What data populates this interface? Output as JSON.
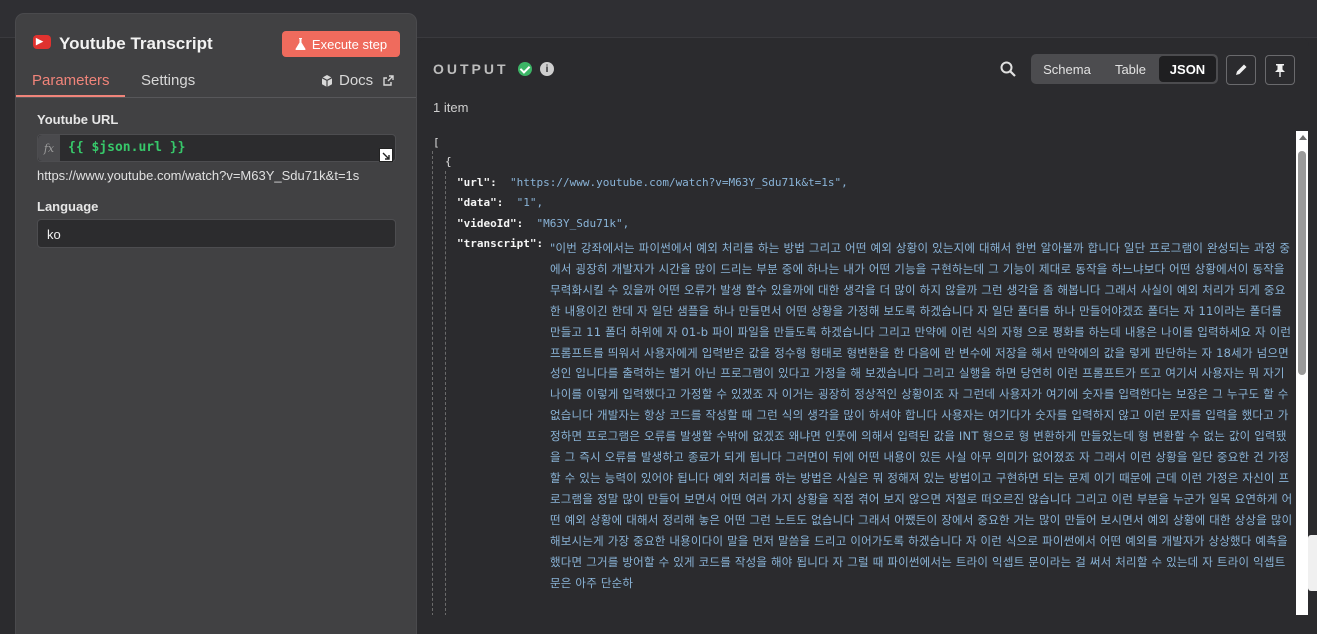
{
  "node": {
    "title": "Youtube Transcript",
    "icon": "youtube-icon",
    "icon_color": "#e0322f",
    "execute_label": "Execute step",
    "accent": "#ef6b5d"
  },
  "tabs": {
    "parameters": "Parameters",
    "settings": "Settings",
    "docs": "Docs"
  },
  "params": {
    "url_label": "Youtube URL",
    "fx": "fx",
    "url_expression": "{{ $json.url }}",
    "url_preview": "https://www.youtube.com/watch?v=M63Y_Sdu71k&t=1s",
    "language_label": "Language",
    "language_value": "ko"
  },
  "output": {
    "title": "OUTPUT",
    "items_count": "1 item",
    "views": [
      "Schema",
      "Table",
      "JSON"
    ],
    "active_view": "JSON",
    "json": {
      "open_bracket": "[",
      "open_brace": "{",
      "url_key": "\"url\":",
      "url_val": "\"https://www.youtube.com/watch?v=M63Y_Sdu71k&t=1s\",",
      "data_key": "\"data\":",
      "data_val": "\"1\",",
      "videoId_key": "\"videoId\":",
      "videoId_val": "\"M63Y_Sdu71k\",",
      "transcript_key": "\"transcript\":",
      "transcript_val": "\"이번 강좌에서는 파이썬에서 예외 처리를 하는 방법 그리고 어떤 예외 상황이 있는지에 대해서 한번 알아볼까 합니다 일단 프로그램이 완성되는 과정 중에서 굉장히 개발자가 시간을 많이 드리는 부분 중에 하나는 내가 어떤 기능을 구현하는데 그 기능이 제대로 동작을 하느냐보다 어떤 상황에서이 동작을 무력화시킬 수 있을까 어떤 오류가 발생 할수 있을까에 대한 생각을 더 많이 하지 않을까 그런 생각을 좀 해봅니다 그래서 사실이 예외 처리가 되게 중요한 내용이긴 한데 자 일단 샘플을 하나 만들면서 어떤 상황을 가정해 보도록 하겠습니다 자 일단 폴더를 하나 만들어야겠죠 폴더는 자 11이라는 폴더를 만들고 11 폴더 하위에 자 01-b 파이 파일을 만들도록 하겠습니다 그리고 만약에 이런 식의 자형 으로 평화를 하는데 내용은 나이를 입력하세요 자 이런 프롬프트를 띄워서 사용자에게 입력받은 값을 정수형 형태로 형변환을 한 다음에 란 변수에 저장을 해서 만약에의 값을 렇게 판단하는 자 18세가 넘으면 성인 입니다를 출력하는 별거 아닌 프로그램이 있다고 가정을 해 보겠습니다 그리고 실행을 하면 당연히 이런 프롬프트가 뜨고 여기서 사용자는 뭐 자기 나이를 이렇게 입력했다고 가정할 수 있겠죠 자 이거는 굉장히 정상적인 상황이죠 자 그런데 사용자가 여기에 숫자를 입력한다는 보장은 그 누구도 할 수 없습니다 개발자는 항상 코드를 작성할 때 그런 식의 생각을 많이 하셔야 합니다 사용자는 여기다가 숫자를 입력하지 않고 이런 문자를 입력을 했다고 가정하면 프로그램은 오류를 발생할 수밖에 없겠죠 왜냐면 인풋에 의해서 입력된 값을 INT 형으로 형 변환하게 만들었는데 형 변환할 수 없는 값이 입력됐을 그 즉시 오류를 발생하고 종료가 되게 됩니다 그러면이 뒤에 어떤 내용이 있든 사실 아무 의미가 없어졌죠 자 그래서 이런 상황을 일단 중요한 건 가정할 수 있는 능력이 있어야 됩니다 예외 처리를 하는 방법은 사실은 뭐 정해져 있는 방법이고 구현하면 되는 문제 이기 때문에 근데 이런 가정은 자신이 프로그램을 정말 많이 만들어 보면서 어떤 여러 가지 상황을 직접 겪어 보지 않으면 저절로 떠오르진 않습니다 그리고 이런 부분을 누군가 일목 요연하게 어떤 예외 상황에 대해서 정리해 놓은 어떤 그런 노트도 없습니다 그래서 어쨌든이 장에서 중요한 거는 많이 만들어 보시면서 예외 상황에 대한 상상을 많이 해보시는게 가장 중요한 내용이다이 말을 먼저 말씀을 드리고 이어가도록 하겠습니다 자 이런 식으로 파이썬에서 어떤 예외를 개발자가 상상했다 예측을 했다면 그거를 방어할 수 있게 코드를 작성을 해야 됩니다 자 그럴 때 파이썬에서는 트라이 익셉트 문이라는 걸 써서 처리할 수 있는데 자 트라이 익셉트 문은 아주 단순하"
    }
  }
}
